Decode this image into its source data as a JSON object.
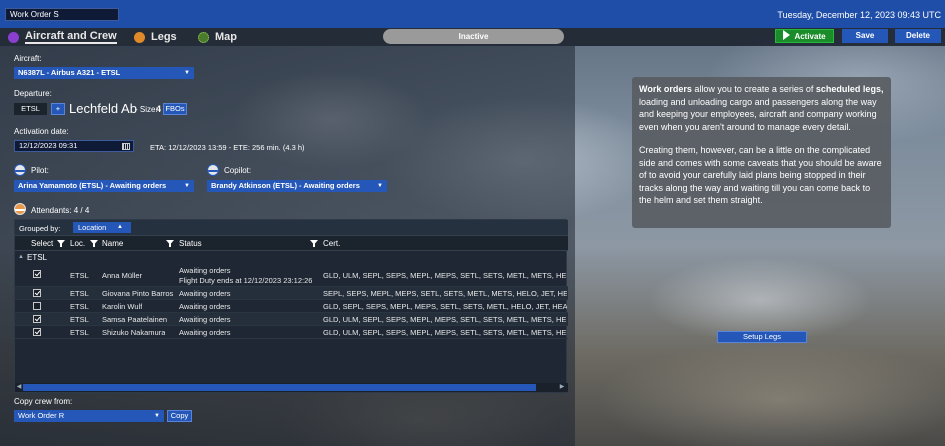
{
  "window": {
    "title_value": "Work Order S",
    "datetime": "Tuesday, December 12, 2023 09:43 UTC"
  },
  "tabs": [
    {
      "label": "Aircraft and Crew",
      "color": "#8a3fd1",
      "active": true
    },
    {
      "label": "Legs",
      "color": "#e08a2a",
      "active": false
    },
    {
      "label": "Map",
      "color": "#4a7a2a",
      "active": false
    }
  ],
  "toolbar": {
    "status": "Inactive",
    "activate_label": "Activate",
    "save_label": "Save",
    "delete_label": "Delete"
  },
  "form": {
    "aircraft_label": "Aircraft:",
    "aircraft_value": "N6387L - Airbus A321 - ETSL",
    "departure_label": "Departure:",
    "departure_code": "ETSL",
    "add_label": "+",
    "departure_name": "Lechfeld Ab",
    "size_prefix": "- Size:",
    "size_value": "4",
    "fbos_label": "FBOs",
    "activation_label": "Activation date:",
    "activation_value": "12/12/2023 09:31",
    "eta_text": "ETA:  12/12/2023 13:59 - ETE:  256 min. (4.3 h)",
    "pilot_label": "Pilot:",
    "pilot_value": "Arina Yamamoto (ETSL) - Awaiting orders",
    "copilot_label": "Copilot:",
    "copilot_value": "Brandy Atkinson (ETSL) - Awaiting orders",
    "attendants_label": "Attendants: 4 / 4"
  },
  "grid": {
    "grouped_by_label": "Grouped by:",
    "group_chip": "Location",
    "columns": [
      "Select",
      "Loc.",
      "Name",
      "Status",
      "Cert."
    ],
    "group_name": "ETSL",
    "rows": [
      {
        "checked": true,
        "loc": "ETSL",
        "name": "Anna Müller",
        "status": "Awaiting orders",
        "status2": "Flight Duty ends at 12/12/2023 23:12:26",
        "cert": "GLD, ULM, SEPL, SEPS, MEPL, MEPS, SETL, SETS, METL, METS, HELO, JET"
      },
      {
        "checked": true,
        "loc": "ETSL",
        "name": "Giovana Pinto Barros",
        "status": "Awaiting orders",
        "status2": "",
        "cert": "SEPL, SEPS, MEPL, MEPS, SETL, SETS, METL, METS, HELO, JET, HEAVYJET"
      },
      {
        "checked": false,
        "loc": "ETSL",
        "name": "Karolin Wulf",
        "status": "Awaiting orders",
        "status2": "",
        "cert": "GLD, SEPL, SEPS, MEPL, MEPS, SETL, SETS, METL, HELO, JET, HEAVYJET"
      },
      {
        "checked": true,
        "loc": "ETSL",
        "name": "Samsa Paatelainen",
        "status": "Awaiting orders",
        "status2": "",
        "cert": "GLD, ULM, SEPL, SEPS, MEPL, MEPS, SETL, SETS, METL, METS, HELO, JET"
      },
      {
        "checked": true,
        "loc": "ETSL",
        "name": "Shizuko Nakamura",
        "status": "Awaiting orders",
        "status2": "",
        "cert": "GLD, ULM, SEPL, SEPS, MEPL, MEPS, SETL, SETS, METL, METS, HELO, JET"
      }
    ]
  },
  "copy": {
    "label": "Copy crew from:",
    "value": "Work Order R",
    "button": "Copy"
  },
  "info": {
    "p1_bold1": "Work orders",
    "p1_text1": " allow you to create a series of ",
    "p1_bold2": "scheduled legs,",
    "p1_text2": " loading and unloading cargo and passengers along the way and keeping your employees, aircraft and company working even when you aren't around to manage every detail.",
    "p2": "Creating them, however, can be a little on the complicated side and comes with some caveats that you should be aware of to avoid your carefully laid plans being stopped in their tracks along the way and waiting till you can come back to the helm and set them straight."
  },
  "setup_legs_label": "Setup Legs"
}
